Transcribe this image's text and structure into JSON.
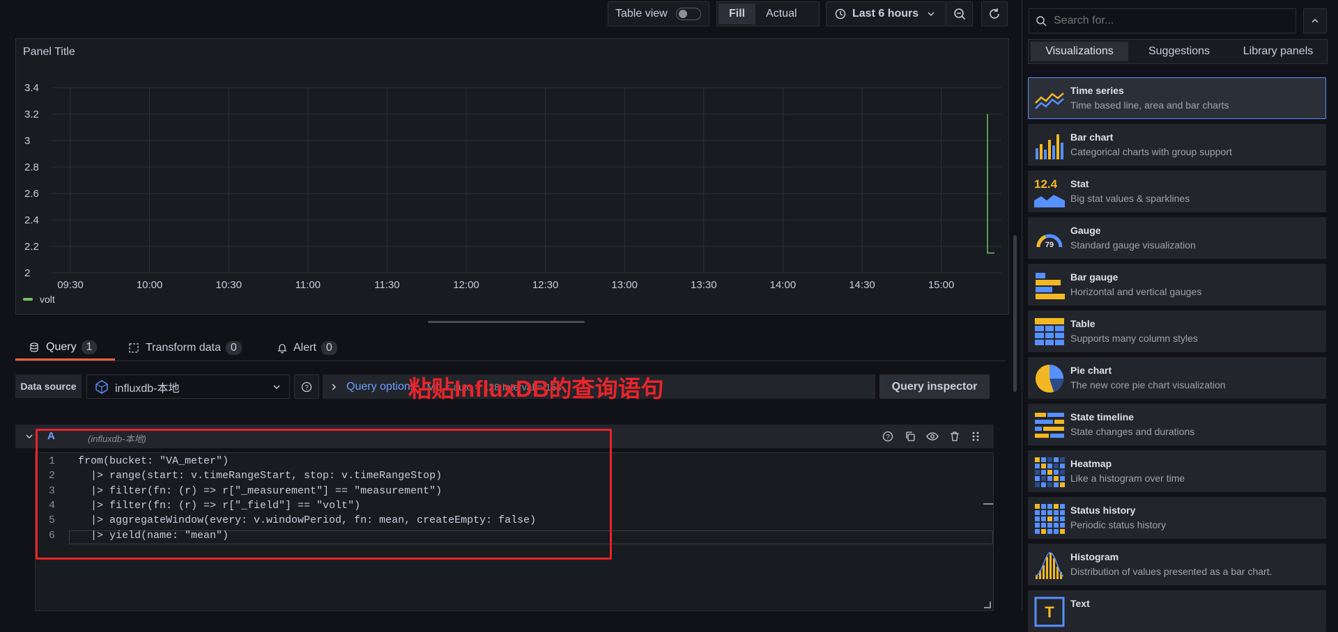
{
  "toolbar": {
    "table_view_label": "Table view",
    "fill_label": "Fill",
    "actual_label": "Actual",
    "time_range_label": "Last 6 hours"
  },
  "panel": {
    "title": "Panel Title",
    "legend_label": "volt"
  },
  "chart_data": {
    "type": "line",
    "title": "Panel Title",
    "y_ticks": [
      "3.4",
      "3.2",
      "3",
      "2.8",
      "2.6",
      "2.4",
      "2.2",
      "2"
    ],
    "x_ticks": [
      "09:30",
      "10:00",
      "10:30",
      "11:00",
      "11:30",
      "12:00",
      "12:30",
      "13:00",
      "13:30",
      "14:00",
      "14:30",
      "15:00"
    ],
    "ylim": [
      2,
      3.4
    ],
    "series": [
      {
        "name": "volt",
        "color": "#73bf69",
        "values": [
          3.2,
          2.15
        ]
      }
    ],
    "grid": true,
    "legend": "bottom-left"
  },
  "query_tabs": [
    {
      "label": "Query",
      "count": "1"
    },
    {
      "label": "Transform data",
      "count": "0"
    },
    {
      "label": "Alert",
      "count": "0"
    }
  ],
  "datasource": {
    "label": "Data source",
    "value": "influxdb-本地",
    "query_options_label": "Query options",
    "query_options_hint": "MD = auto = 128   Interval = 15s",
    "query_inspector_label": "Query inspector"
  },
  "annotation_text": "粘贴InfluxDB的查询语句",
  "query_row": {
    "ref_id": "A",
    "datasource_hint": "(influxdb-本地)"
  },
  "code_lines": [
    {
      "num": "1",
      "text": "from(bucket: \"VA_meter\")"
    },
    {
      "num": "2",
      "text": "  |> range(start: v.timeRangeStart, stop: v.timeRangeStop)"
    },
    {
      "num": "3",
      "text": "  |> filter(fn: (r) => r[\"_measurement\"] == \"measurement\")"
    },
    {
      "num": "4",
      "text": "  |> filter(fn: (r) => r[\"_field\"] == \"volt\")"
    },
    {
      "num": "5",
      "text": "  |> aggregateWindow(every: v.windowPeriod, fn: mean, createEmpty: false)"
    },
    {
      "num": "6",
      "text": "  |> yield(name: \"mean\")"
    }
  ],
  "sidebar": {
    "search_placeholder": "Search for...",
    "tabs": [
      "Visualizations",
      "Suggestions",
      "Library panels"
    ],
    "items": [
      {
        "title": "Time series",
        "desc": "Time based line, area and bar charts",
        "icon": "time-series-icon"
      },
      {
        "title": "Bar chart",
        "desc": "Categorical charts with group support",
        "icon": "bar-chart-icon"
      },
      {
        "title": "Stat",
        "desc": "Big stat values & sparklines",
        "icon": "stat-icon",
        "icon_text": "12.4"
      },
      {
        "title": "Gauge",
        "desc": "Standard gauge visualization",
        "icon": "gauge-icon",
        "icon_text": "79"
      },
      {
        "title": "Bar gauge",
        "desc": "Horizontal and vertical gauges",
        "icon": "bar-gauge-icon"
      },
      {
        "title": "Table",
        "desc": "Supports many column styles",
        "icon": "table-icon"
      },
      {
        "title": "Pie chart",
        "desc": "The new core pie chart visualization",
        "icon": "pie-chart-icon"
      },
      {
        "title": "State timeline",
        "desc": "State changes and durations",
        "icon": "state-timeline-icon"
      },
      {
        "title": "Heatmap",
        "desc": "Like a histogram over time",
        "icon": "heatmap-icon"
      },
      {
        "title": "Status history",
        "desc": "Periodic status history",
        "icon": "status-history-icon"
      },
      {
        "title": "Histogram",
        "desc": "Distribution of values presented as a bar chart.",
        "icon": "histogram-icon"
      },
      {
        "title": "Text",
        "desc": "",
        "icon": "text-icon"
      }
    ]
  }
}
